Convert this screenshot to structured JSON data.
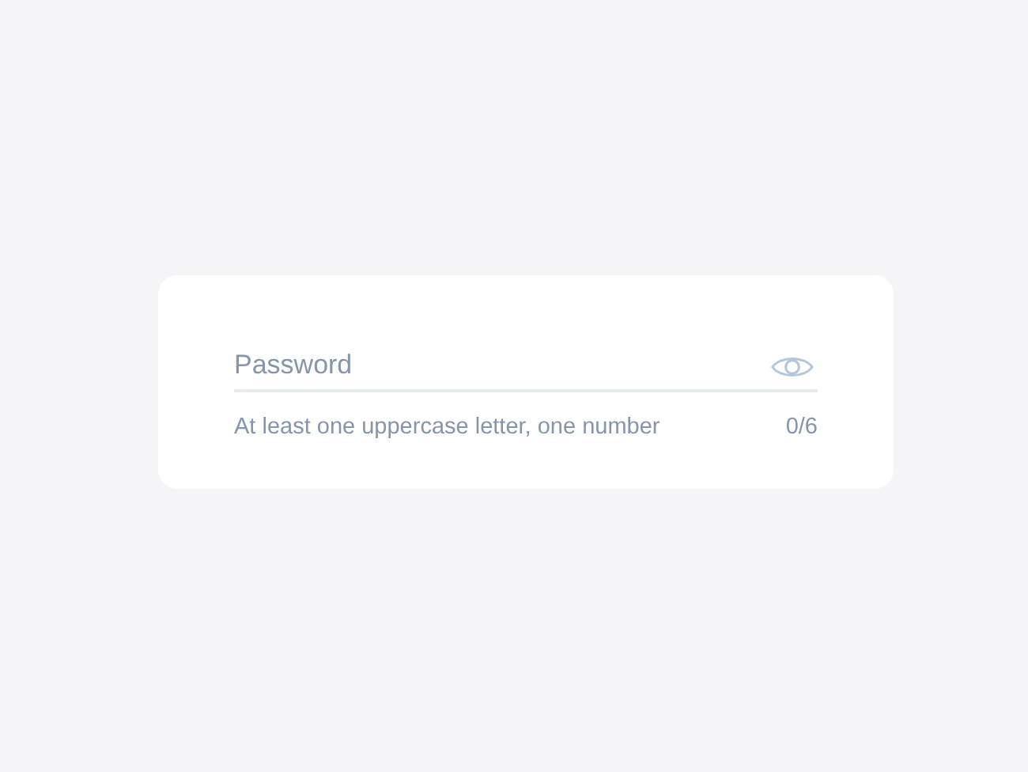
{
  "password_field": {
    "placeholder": "Password",
    "hint": "At least one uppercase letter, one number",
    "counter": "0/6"
  }
}
